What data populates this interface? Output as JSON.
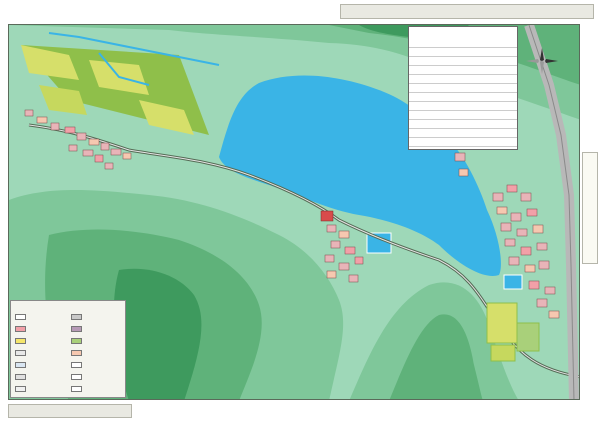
{
  "header": {
    "prefix": "",
    "highlight": "",
    "suffix": ""
  },
  "side_label": "",
  "footer": "",
  "water_label": "",
  "legend": {
    "title": "",
    "items": [
      {
        "label": "",
        "color": "#ffffff"
      },
      {
        "label": "",
        "color": "#c9c9c9"
      },
      {
        "label": "",
        "color": "#f2a0a8"
      },
      {
        "label": "",
        "color": "#b69ab6"
      },
      {
        "label": "",
        "color": "#f5e66b"
      },
      {
        "label": "",
        "color": "#a9d07a"
      },
      {
        "label": "",
        "color": "#e8e8e8"
      },
      {
        "label": "",
        "color": "#f6c8b0"
      },
      {
        "label": "",
        "color": "#d9e6f2"
      },
      {
        "label": "",
        "color": "#ffffff"
      },
      {
        "label": "",
        "color": "#e0e0e0"
      },
      {
        "label": "",
        "color": "#ffffff"
      },
      {
        "label": "",
        "color": "#f0f0f0"
      },
      {
        "label": "",
        "color": "#ffffff"
      }
    ]
  },
  "table": {
    "title": "",
    "rows": [
      {
        "name": "",
        "unit": "",
        "value": ""
      },
      {
        "name": "",
        "unit": "",
        "value": ""
      },
      {
        "name": "",
        "unit": "",
        "value": ""
      },
      {
        "name": "",
        "unit": "",
        "value": ""
      },
      {
        "name": "",
        "unit": "",
        "value": ""
      },
      {
        "name": "",
        "unit": "",
        "value": ""
      },
      {
        "name": "",
        "unit": "",
        "value": ""
      },
      {
        "name": "",
        "unit": "",
        "value": ""
      },
      {
        "name": "",
        "unit": "",
        "value": ""
      },
      {
        "name": "",
        "unit": "",
        "value": ""
      },
      {
        "name": "",
        "unit": "",
        "value": ""
      },
      {
        "name": "",
        "unit": "",
        "value": ""
      }
    ]
  },
  "compass": {
    "label": ""
  },
  "colors": {
    "terrain_low": "#9ed8b8",
    "terrain_mid": "#7fc79a",
    "terrain_high": "#5fb27a",
    "terrain_peak": "#3e9a5e",
    "lake": "#3ab4e6",
    "road": "#556b55",
    "buildings": "#e8b4b8",
    "farmland_light": "#d6df6a",
    "farmland_dark": "#8fbf4a",
    "highway": "#b8b8b8"
  },
  "icons": [
    "compass-rose-icon"
  ]
}
